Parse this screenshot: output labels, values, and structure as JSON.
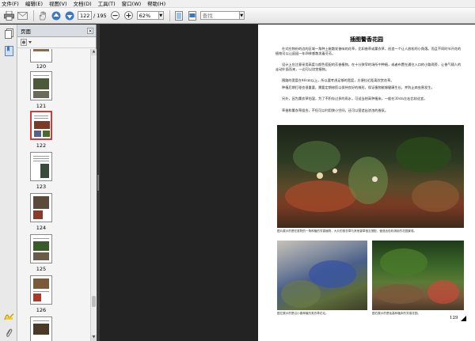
{
  "menu": [
    {
      "label": "文件(F)"
    },
    {
      "label": "编辑(E)"
    },
    {
      "label": "视图(V)"
    },
    {
      "label": "文档(D)"
    },
    {
      "label": "工具(T)"
    },
    {
      "label": "窗口(W)"
    },
    {
      "label": "帮助(H)"
    }
  ],
  "toolbar": {
    "page_current": "122",
    "page_total": "/ 195",
    "zoom": "62%",
    "find_placeholder": "查找"
  },
  "panel": {
    "title": "页面",
    "close": "×"
  },
  "thumbnails": [
    {
      "label": "120"
    },
    {
      "label": "121"
    },
    {
      "label": "122"
    },
    {
      "label": "123"
    },
    {
      "label": "124"
    },
    {
      "label": "125"
    },
    {
      "label": "126"
    }
  ],
  "page": {
    "title": "插图警香花园",
    "paragraphs": [
      "在对应物份的边的区域一角种上能散发香味的花草，比如香草或薰衣草，创造一个让人放松的小角落。而且不同时节开花的植物可以让庭园一年四季都散发着芬芳。",
      "设计上应注意采用高度与颜色搭配的芳香植物，在十分狭窄的场所中种植，或者布置在通往入口的小路两旁，让香气随人的走动扑面而来，一边可以欣赏植物。",
      "围路的宽度在40cm以上，所以要考虑足够的宽度，方便拉近距离欣赏花草。",
      "种植后期打理也很重要，需要定期修剪以保持良好的株形，保证植物能够健康生长，并防止病虫害发生。",
      "另外，因为薰衣草怕湿，为了不积存过多的雨水，可适当抬高种植床，一般在30cm左右比较适宜。",
      "草香和薰衣草组合，不但可以利用狭小空间，还可以营造出浓浓的香氛。"
    ],
    "caption_main": "图片展示的是在庭院的一角种植的芳香植物，大片的薰衣草与其他香草相互搭配，营造出色彩缤纷的花园景观。",
    "caption_a": "图左展示的是沿小路种植的薰衣草花坛。",
    "caption_b": "图右展示的是抬高种植床的芳香花园。",
    "page_number": "129"
  }
}
